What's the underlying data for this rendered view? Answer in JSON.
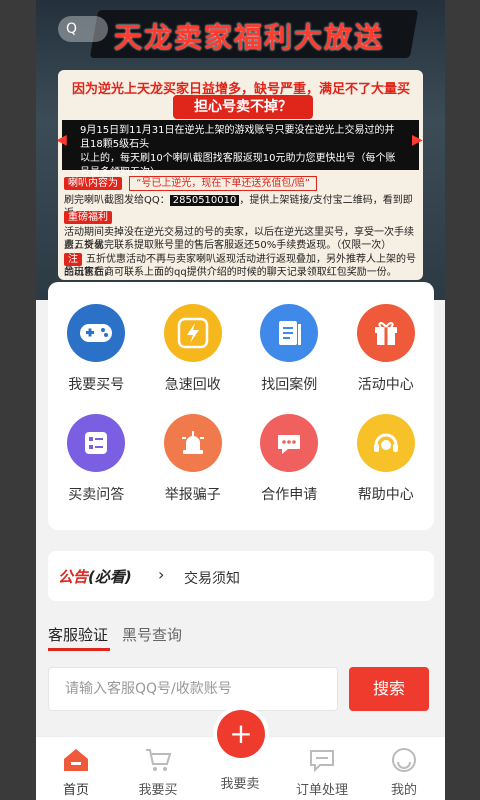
{
  "banner": {
    "title": "天龙卖家福利大放送",
    "mini_search": "Q",
    "notice": {
      "line1": "因为逆光上天龙买家日益增多，缺号严重，满足不了大量买家的需求",
      "pill": "担心号卖不掉？",
      "dark_a": "9月15日到11月31日在逆光上架的游戏账号只要没在逆光上交易过的并且18颗5级石头",
      "dark_b": "以上的，每天刷10个喇叭截图找客服返现10元助力您更快出号（每个账号最多领取五次）。",
      "horn_tag": "喇叭内容为",
      "horn_box": "“号已上逆光，现在下单还送充值包/赔”",
      "screenshot_line_a": "刷完喇叭截图发给QQ：",
      "qq": "2850510010",
      "screenshot_line_b": "，提供上架链接/支付宝二维码，看到即返。",
      "bonus_tag": "重磅福利",
      "bonus_a": "活动期间卖掉没在逆光交易过的号的卖家，以后在逆光这里买号，享受一次手续费五折优",
      "bonus_b": "惠，交易完联系提取账号里的售后客服返还50%手续费返现。（仅限一次）",
      "note_tag": "注",
      "note_a": "五折优惠活动不再与卖家喇叭返现活动进行返现叠加，另外推荐人上架的号的玩家在商",
      "note_b": "品出售后，可联系上面的qq提供介绍的时候的聊天记录领取红包奖励一份。"
    }
  },
  "menu": [
    {
      "label": "我要买号",
      "icon": "gamepad-icon",
      "color": "#2b71c8"
    },
    {
      "label": "急速回收",
      "icon": "lightning-icon",
      "color": "#f5b71c"
    },
    {
      "label": "找回案例",
      "icon": "document-icon",
      "color": "#3f8ae8"
    },
    {
      "label": "活动中心",
      "icon": "gift-icon",
      "color": "#ef5a3a"
    },
    {
      "label": "买卖问答",
      "icon": "list-icon",
      "color": "#7b5fe3"
    },
    {
      "label": "举报骗子",
      "icon": "siren-icon",
      "color": "#f07a4c"
    },
    {
      "label": "合作申请",
      "icon": "chat-bubble-icon",
      "color": "#f0605e"
    },
    {
      "label": "帮助中心",
      "icon": "headset-icon",
      "color": "#f7c12a"
    }
  ],
  "announcement": {
    "tag_red": "公告",
    "tag_black": "(必看)",
    "text": "交易须知",
    "accent": "#e0251b"
  },
  "tabs": [
    "客服验证",
    "黑号查询"
  ],
  "search": {
    "placeholder": "请输入客服QQ号/收款账号",
    "button": "搜索"
  },
  "tabbar": [
    {
      "label": "首页",
      "icon": "home-icon"
    },
    {
      "label": "我要买",
      "icon": "cart-icon"
    },
    {
      "label": "我要卖",
      "icon": "plus-icon"
    },
    {
      "label": "订单处理",
      "icon": "chat-icon"
    },
    {
      "label": "我的",
      "icon": "profile-icon"
    }
  ],
  "fab": "+"
}
